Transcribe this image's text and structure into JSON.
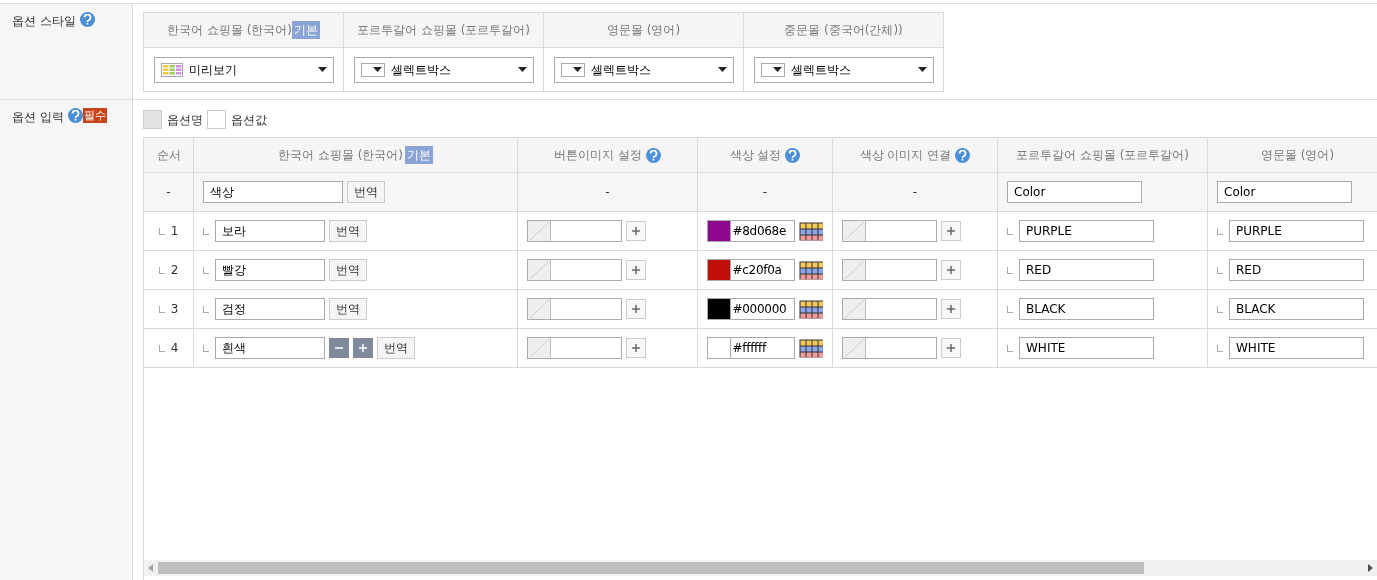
{
  "style_section": {
    "label": "옵션 스타일",
    "help": true,
    "columns": [
      {
        "title": "한국어 쇼핑몰 (한국어)",
        "badge": "기본",
        "select": {
          "kind": "preview",
          "value": "미리보기"
        }
      },
      {
        "title": "포르투갈어 쇼핑몰 (포르투갈어)",
        "select": {
          "kind": "selectbox",
          "value": "셀렉트박스"
        }
      },
      {
        "title": "영문몰 (영어)",
        "select": {
          "kind": "selectbox",
          "value": "셀렉트박스"
        }
      },
      {
        "title": "중문몰 (중국어(간체))",
        "select": {
          "kind": "selectbox",
          "value": "셀렉트박스"
        }
      }
    ]
  },
  "input_section": {
    "label": "옵션 입력",
    "help": true,
    "badge": "필수",
    "toggles": [
      {
        "label": "옵션명",
        "selected": true
      },
      {
        "label": "옵션값",
        "selected": false
      }
    ],
    "columns": [
      {
        "title": "순서"
      },
      {
        "title": "한국어 쇼핑몰 (한국어)",
        "badge": "기본"
      },
      {
        "title": "버튼이미지 설정",
        "help": true
      },
      {
        "title": "색상 설정",
        "help": true
      },
      {
        "title": "색상 이미지 연결",
        "help": true
      },
      {
        "title": "포르투갈어 쇼핑몰 (포르투갈어)"
      },
      {
        "title": "영문몰 (영어)"
      }
    ],
    "name_row": {
      "order": "-",
      "name": "색상",
      "translate": "번역",
      "button_image": "-",
      "color_setting": "-",
      "color_image": "-",
      "pt": "Color",
      "en": "Color"
    },
    "rows": [
      {
        "order": "1",
        "name": "보라",
        "translate": "번역",
        "color": "#8d068e",
        "color_value": "#8d068e",
        "pt": "PURPLE",
        "en": "PURPLE",
        "row_controls": false
      },
      {
        "order": "2",
        "name": "빨강",
        "translate": "번역",
        "color": "#c20f0a",
        "color_value": "#c20f0a",
        "pt": "RED",
        "en": "RED",
        "row_controls": false
      },
      {
        "order": "3",
        "name": "검정",
        "translate": "번역",
        "color": "#000000",
        "color_value": "#000000",
        "pt": "BLACK",
        "en": "BLACK",
        "row_controls": false
      },
      {
        "order": "4",
        "name": "흰색",
        "translate": "번역",
        "color": "#ffffff",
        "color_value": "#ffffff",
        "pt": "WHITE",
        "en": "WHITE",
        "row_controls": true
      }
    ]
  }
}
